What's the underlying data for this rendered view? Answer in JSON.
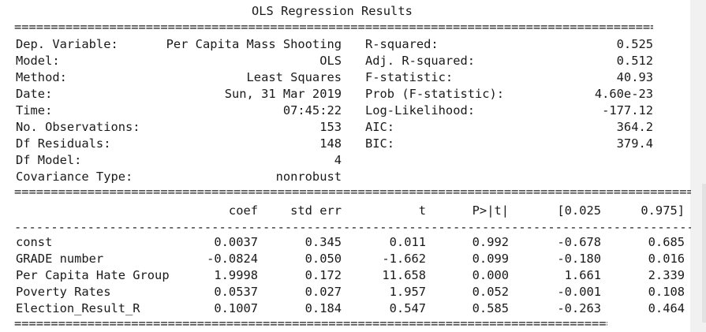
{
  "title": "OLS Regression Results",
  "rule_eq": "========================================================================================================",
  "rule_dash": "--------------------------------------------------------------------------------------------------------",
  "summary_rows": [
    {
      "label": "Dep. Variable:",
      "value": "Per Capita Mass Shooting",
      "stat_label": "R-squared:",
      "stat_value": "0.525"
    },
    {
      "label": "Model:",
      "value": "OLS",
      "stat_label": "Adj. R-squared:",
      "stat_value": "0.512"
    },
    {
      "label": "Method:",
      "value": "Least Squares",
      "stat_label": "F-statistic:",
      "stat_value": "40.93"
    },
    {
      "label": "Date:",
      "value": "Sun, 31 Mar 2019",
      "stat_label": "Prob (F-statistic):",
      "stat_value": "4.60e-23"
    },
    {
      "label": "Time:",
      "value": "07:45:22",
      "stat_label": "Log-Likelihood:",
      "stat_value": "-177.12"
    },
    {
      "label": "No. Observations:",
      "value": "153",
      "stat_label": "AIC:",
      "stat_value": "364.2"
    },
    {
      "label": "Df Residuals:",
      "value": "148",
      "stat_label": "BIC:",
      "stat_value": "379.4"
    },
    {
      "label": "Df Model:",
      "value": "4",
      "stat_label": "",
      "stat_value": ""
    },
    {
      "label": "Covariance Type:",
      "value": "nonrobust",
      "stat_label": "",
      "stat_value": ""
    }
  ],
  "coef_header": [
    "coef",
    "std err",
    "t",
    "P>|t|",
    "[0.025",
    "0.975]"
  ],
  "coef_rows": [
    {
      "name": "const",
      "values": [
        "0.0037",
        "0.345",
        "0.011",
        "0.992",
        "-0.678",
        "0.685"
      ]
    },
    {
      "name": "GRADE number",
      "values": [
        "-0.0824",
        "0.050",
        "-1.662",
        "0.099",
        "-0.180",
        "0.016"
      ]
    },
    {
      "name": "Per Capita Hate Group",
      "values": [
        "1.9998",
        "0.172",
        "11.658",
        "0.000",
        "1.661",
        "2.339"
      ]
    },
    {
      "name": "Poverty Rates",
      "values": [
        "0.0537",
        "0.027",
        "1.957",
        "0.052",
        "-0.001",
        "0.108"
      ]
    },
    {
      "name": "Election_Result_R",
      "values": [
        "0.1007",
        "0.184",
        "0.547",
        "0.585",
        "-0.263",
        "0.464"
      ]
    }
  ]
}
